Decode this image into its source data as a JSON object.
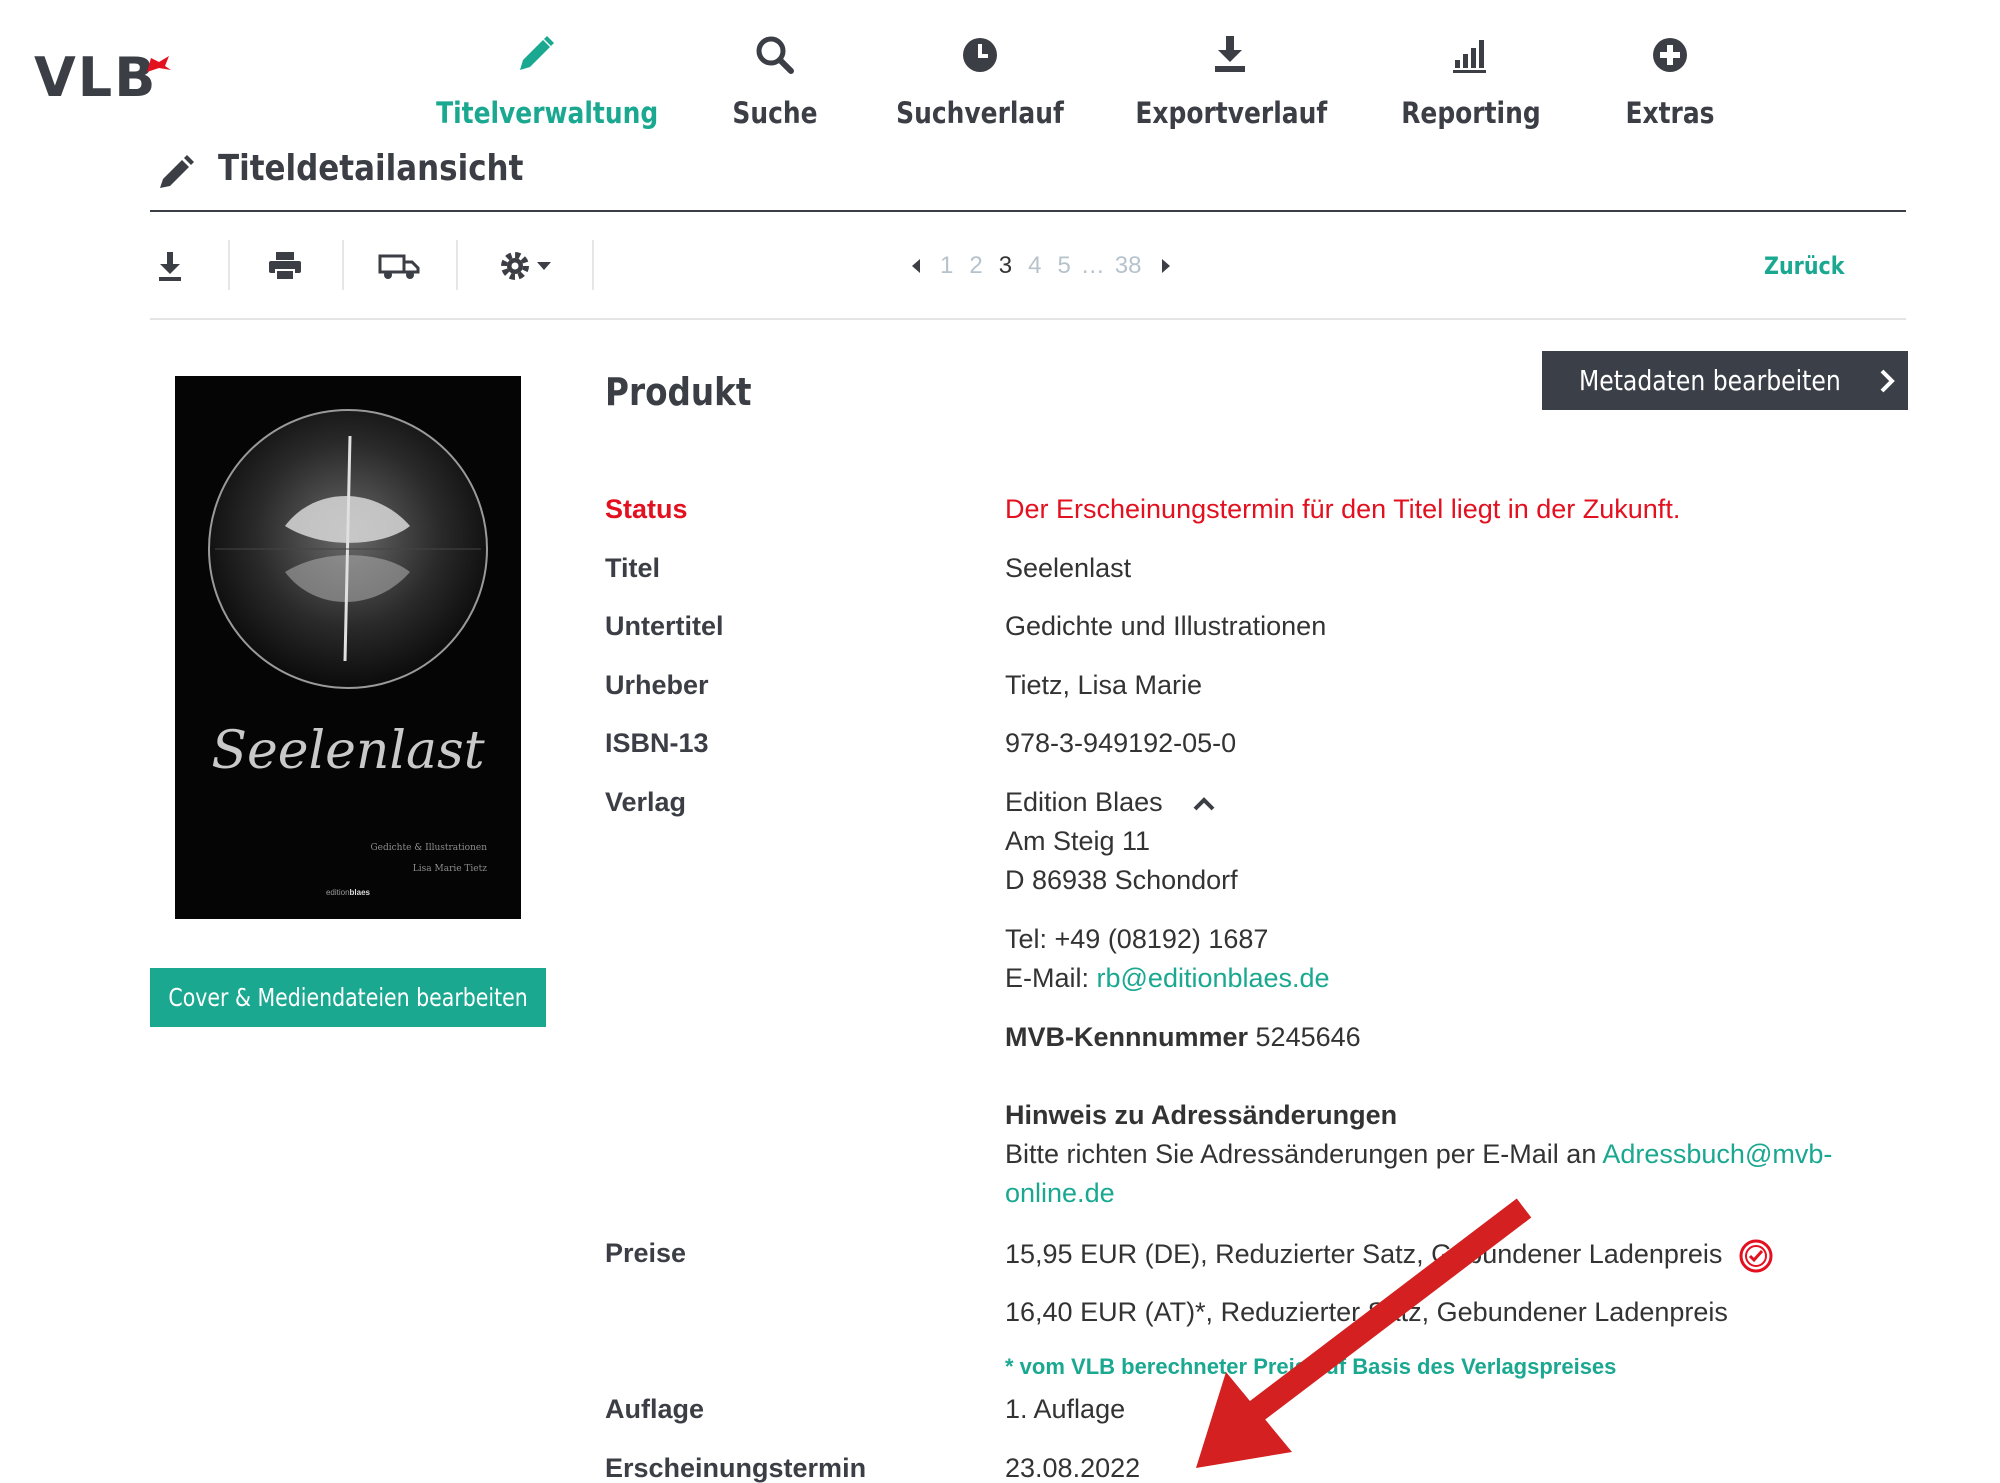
{
  "app": {
    "logo_text": "VLB"
  },
  "nav": [
    {
      "label": "Titelverwaltung",
      "icon": "pencil-icon",
      "active": true
    },
    {
      "label": "Suche",
      "icon": "search-icon",
      "active": false
    },
    {
      "label": "Suchverlauf",
      "icon": "clock-icon",
      "active": false
    },
    {
      "label": "Exportverlauf",
      "icon": "download-tray-icon",
      "active": false
    },
    {
      "label": "Reporting",
      "icon": "bar-chart-icon",
      "active": false
    },
    {
      "label": "Extras",
      "icon": "plus-circle-icon",
      "active": false
    }
  ],
  "page": {
    "title": "Titeldetailansicht"
  },
  "toolbar": {
    "pages": [
      "1",
      "2",
      "3",
      "4",
      "5"
    ],
    "ellipsis": "…",
    "last_page": "38",
    "current_page": "3",
    "back_label": "Zurück"
  },
  "cover": {
    "title": "Seelenlast",
    "subtitle": "Gedichte & Illustrationen",
    "author": "Lisa Marie Tietz",
    "publisher_prefix": "edition",
    "publisher_bold": "blaes",
    "edit_button": "Cover & Mediendateien bearbeiten"
  },
  "product": {
    "heading": "Produkt",
    "edit_button": "Metadaten bearbeiten",
    "status_label": "Status",
    "status_value": "Der Erscheinungstermin für den Titel liegt in der Zukunft.",
    "title_label": "Titel",
    "title_value": "Seelenlast",
    "subtitle_label": "Untertitel",
    "subtitle_value": "Gedichte und Illustrationen",
    "author_label": "Urheber",
    "author_value": "Tietz, Lisa Marie",
    "isbn_label": "ISBN-13",
    "isbn_value": "978-3-949192-05-0",
    "publisher_label": "Verlag",
    "publisher_name": "Edition Blaes",
    "publisher_street": "Am Steig 11",
    "publisher_city": "D 86938 Schondorf",
    "publisher_tel": "Tel: +49 (08192) 1687",
    "publisher_email_prefix": "E-Mail: ",
    "publisher_email": "rb@editionblaes.de",
    "mvb_label": "MVB-Kennnummer",
    "mvb_value": "5245646",
    "hint_title": "Hinweis zu Adressänderungen",
    "hint_text": "Bitte richten Sie Adressänderungen per E-Mail an ",
    "hint_email_1": "Adressbuch@mvb-",
    "hint_email_2": "online.de",
    "prices_label": "Preise",
    "price_de": "15,95 EUR (DE), Reduzierter Satz, Gebundener Ladenpreis",
    "price_at": "16,40 EUR (AT)*, Reduzierter Satz, Gebundener Ladenpreis",
    "price_note": "* vom VLB berechneter Preis auf Basis des Verlagspreises",
    "edition_label": "Auflage",
    "edition_value": "1. Auflage",
    "release_label": "Erscheinungstermin",
    "release_value": "23.08.2022"
  },
  "colors": {
    "accent": "#1aa891",
    "dark": "#3b3e44",
    "status_red": "#e3101f",
    "arrow_red": "#d42020"
  }
}
